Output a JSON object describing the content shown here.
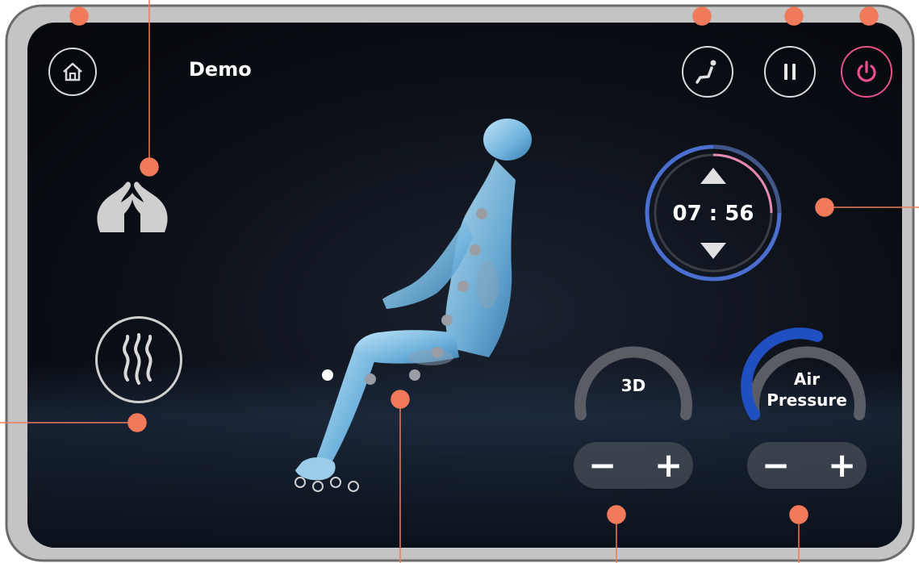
{
  "header": {
    "title": "Demo"
  },
  "icons": {
    "home": "home-icon",
    "recline": "recline-icon",
    "pause": "pause-icon",
    "power": "power-icon",
    "hands": "hands-icon",
    "heat": "heat-icon"
  },
  "timer": {
    "minutes": "07",
    "separator": ":",
    "seconds": "56",
    "up_icon": "triangle-up-icon",
    "down_icon": "triangle-down-icon"
  },
  "gauges": [
    {
      "label_line1": "3D",
      "label_line2": "",
      "level": 0,
      "minus": "−",
      "plus": "+"
    },
    {
      "label_line1": "Air",
      "label_line2": "Pressure",
      "level": 0.25,
      "minus": "−",
      "plus": "+"
    }
  ],
  "colors": {
    "power_accent": "#e8508c",
    "timer_ring": "#4a6fd0",
    "timer_progress": "#e48ab0",
    "annotation": "#f07a5a",
    "air_pressure_arc": "#1f4fc0",
    "gauge_track": "#5a5d63"
  }
}
